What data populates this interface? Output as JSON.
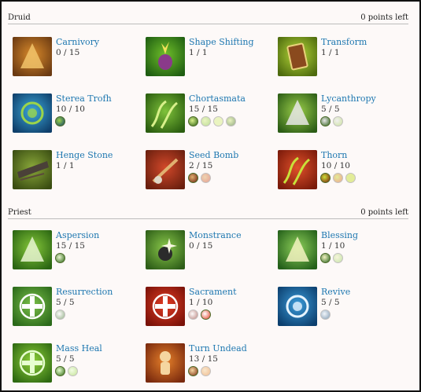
{
  "sections": [
    {
      "name": "Druid",
      "points": "0 points left",
      "skills": [
        {
          "name": "Carnivory",
          "rank": "0 / 15",
          "icon": "carnivory-icon",
          "palette": [
            "#6b3a12",
            "#d98a2b",
            "#f1c36a"
          ],
          "reqs": []
        },
        {
          "name": "Shape Shifting",
          "rank": "1 / 1",
          "icon": "shape-shifting-icon",
          "palette": [
            "#1f5e12",
            "#6fbf2a",
            "#f2e25a"
          ],
          "reqs": []
        },
        {
          "name": "Transform",
          "rank": "1 / 1",
          "icon": "transform-icon",
          "palette": [
            "#4e6b0e",
            "#b7d93a",
            "#8a4a1e"
          ],
          "reqs": []
        },
        {
          "name": "Sterea Trofh",
          "rank": "10 / 10",
          "icon": "sterea-trofh-icon",
          "palette": [
            "#0f3f6b",
            "#3ca7d8",
            "#9bd44a"
          ],
          "reqs": [
            "on"
          ]
        },
        {
          "name": "Chortasmata",
          "rank": "15 / 15",
          "icon": "chortasmata-icon",
          "palette": [
            "#2b5e10",
            "#7fc23a",
            "#d8f08a"
          ],
          "reqs": [
            "on",
            "faded",
            "faded",
            "faded"
          ]
        },
        {
          "name": "Lycanthropy",
          "rank": "5 / 5",
          "icon": "lycanthropy-icon",
          "palette": [
            "#2c5d16",
            "#9ccf4a",
            "#e6e6e6"
          ],
          "reqs": [
            "on",
            "faded"
          ]
        },
        {
          "name": "Henge Stone",
          "rank": "1 / 1",
          "icon": "henge-stone-icon",
          "palette": [
            "#3a4d12",
            "#8aa83a",
            "#5b4a3a"
          ],
          "reqs": []
        },
        {
          "name": "Seed Bomb",
          "rank": "2 / 15",
          "icon": "seed-bomb-icon",
          "palette": [
            "#6a1f0e",
            "#d2482a",
            "#e0b070"
          ],
          "reqs": [
            "on",
            "faded"
          ]
        },
        {
          "name": "Thorn",
          "rank": "10 / 10",
          "icon": "thorn-icon",
          "palette": [
            "#7a1a0a",
            "#e0502a",
            "#c9e03a"
          ],
          "reqs": [
            "on",
            "faded",
            "faded"
          ]
        }
      ]
    },
    {
      "name": "Priest",
      "points": "0 points left",
      "skills": [
        {
          "name": "Aspersion",
          "rank": "15 / 15",
          "icon": "aspersion-icon",
          "palette": [
            "#2a6512",
            "#86c83a",
            "#e8f5d0"
          ],
          "reqs": [
            "on"
          ]
        },
        {
          "name": "Monstrance",
          "rank": "0 / 15",
          "icon": "monstrance-icon",
          "palette": [
            "#2e5e18",
            "#8ac84a",
            "#f7f7e0"
          ],
          "reqs": []
        },
        {
          "name": "Blessing",
          "rank": "1 / 10",
          "icon": "blessing-icon",
          "palette": [
            "#24601a",
            "#8ed05a",
            "#f2f2c0"
          ],
          "reqs": [
            "on",
            "faded"
          ]
        },
        {
          "name": "Resurrection",
          "rank": "5 / 5",
          "icon": "resurrection-icon",
          "palette": [
            "#2b6a1a",
            "#7bc04a",
            "#ffffff"
          ],
          "reqs": [
            "faded"
          ]
        },
        {
          "name": "Sacrament",
          "rank": "1 / 10",
          "icon": "sacrament-icon",
          "palette": [
            "#7a1208",
            "#e43c24",
            "#ffffff"
          ],
          "reqs": [
            "faded",
            "on"
          ]
        },
        {
          "name": "Revive",
          "rank": "5 / 5",
          "icon": "revive-icon",
          "palette": [
            "#0c3f6e",
            "#3a9ad8",
            "#e6f4ff"
          ],
          "reqs": [
            "faded"
          ]
        },
        {
          "name": "Mass Heal",
          "rank": "5 / 5",
          "icon": "mass-heal-icon",
          "palette": [
            "#2f6a12",
            "#8ed03a",
            "#e7ffd0"
          ],
          "reqs": [
            "on",
            "faded"
          ]
        },
        {
          "name": "Turn Undead",
          "rank": "13 / 15",
          "icon": "turn-undead-icon",
          "palette": [
            "#7a2a0e",
            "#e6802a",
            "#f5d6a0"
          ],
          "reqs": [
            "on",
            "faded"
          ]
        }
      ]
    }
  ]
}
